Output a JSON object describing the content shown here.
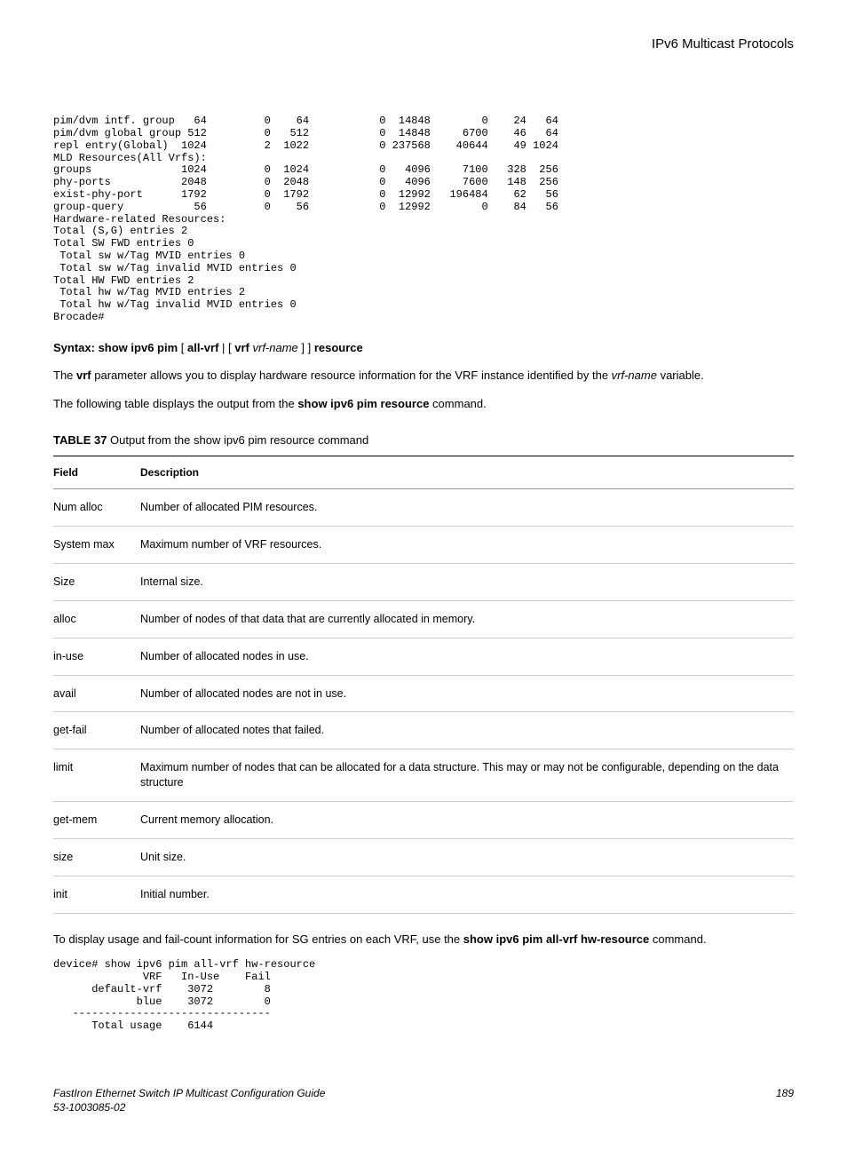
{
  "header": {
    "section": "IPv6 Multicast Protocols"
  },
  "code1": "pim/dvm intf. group   64         0    64           0  14848        0    24   64\npim/dvm global group 512         0   512           0  14848     6700    46   64\nrepl entry(Global)  1024         2  1022           0 237568    40644    49 1024\nMLD Resources(All Vrfs):\ngroups              1024         0  1024           0   4096     7100   328  256\nphy-ports           2048         0  2048           0   4096     7600   148  256\nexist-phy-port      1792         0  1792           0  12992   196484    62   56\ngroup-query           56         0    56           0  12992        0    84   56\nHardware-related Resources:\nTotal (S,G) entries 2\nTotal SW FWD entries 0\n Total sw w/Tag MVID entries 0\n Total sw w/Tag invalid MVID entries 0\nTotal HW FWD entries 2\n Total hw w/Tag MVID entries 2\n Total hw w/Tag invalid MVID entries 0\nBrocade#",
  "syntax": {
    "prefix": "Syntax: show ipv6 pim",
    "opt1": " [ ",
    "allvrf": "all-vrf",
    "pipe": " | [ ",
    "vrf": "vrf",
    "space": " ",
    "vrfname": "vrf-name",
    "close": " ] ] ",
    "resource": "resource"
  },
  "para1": {
    "t1": "The ",
    "b1": "vrf",
    "t2": " parameter allows you to display hardware resource information for the VRF instance identified by the ",
    "i1": "vrf-name",
    "t3": " variable."
  },
  "para2": {
    "t1": "The following table displays the output from the ",
    "b1": "show ipv6 pim resource",
    "t2": " command."
  },
  "tablecap": {
    "label": "TABLE 37",
    "text": "   Output from the show ipv6 pim resource command"
  },
  "table": {
    "h1": "Field",
    "h2": "Description",
    "rows": [
      {
        "f": "Num alloc",
        "d": "Number of allocated PIM resources."
      },
      {
        "f": "System max",
        "d": "Maximum number of VRF resources."
      },
      {
        "f": "Size",
        "d": "Internal size."
      },
      {
        "f": "alloc",
        "d": "Number of nodes of that data that are currently allocated in memory."
      },
      {
        "f": "in-use",
        "d": "Number of allocated nodes in use."
      },
      {
        "f": "avail",
        "d": "Number of allocated nodes are not in use."
      },
      {
        "f": "get-fail",
        "d": "Number of allocated notes that failed."
      },
      {
        "f": "limit",
        "d": "Maximum number of nodes that can be allocated for a data structure. This may or may not be configurable, depending on the data structure"
      },
      {
        "f": "get-mem",
        "d": "Current memory allocation."
      },
      {
        "f": "size",
        "d": "Unit size."
      },
      {
        "f": "init",
        "d": "Initial number."
      }
    ]
  },
  "para3": {
    "t1": "To display usage and fail-count information for SG entries on each VRF, use the ",
    "b1": "show ipv6 pim all-vrf hw-resource",
    "t2": " command."
  },
  "code2": "device# show ipv6 pim all-vrf hw-resource\n              VRF   In-Use    Fail\n      default-vrf    3072        8\n             blue    3072        0\n   -------------------------------\n      Total usage    6144",
  "footer": {
    "title": "FastIron Ethernet Switch IP Multicast Configuration Guide",
    "docnum": "53-1003085-02",
    "page": "189"
  }
}
